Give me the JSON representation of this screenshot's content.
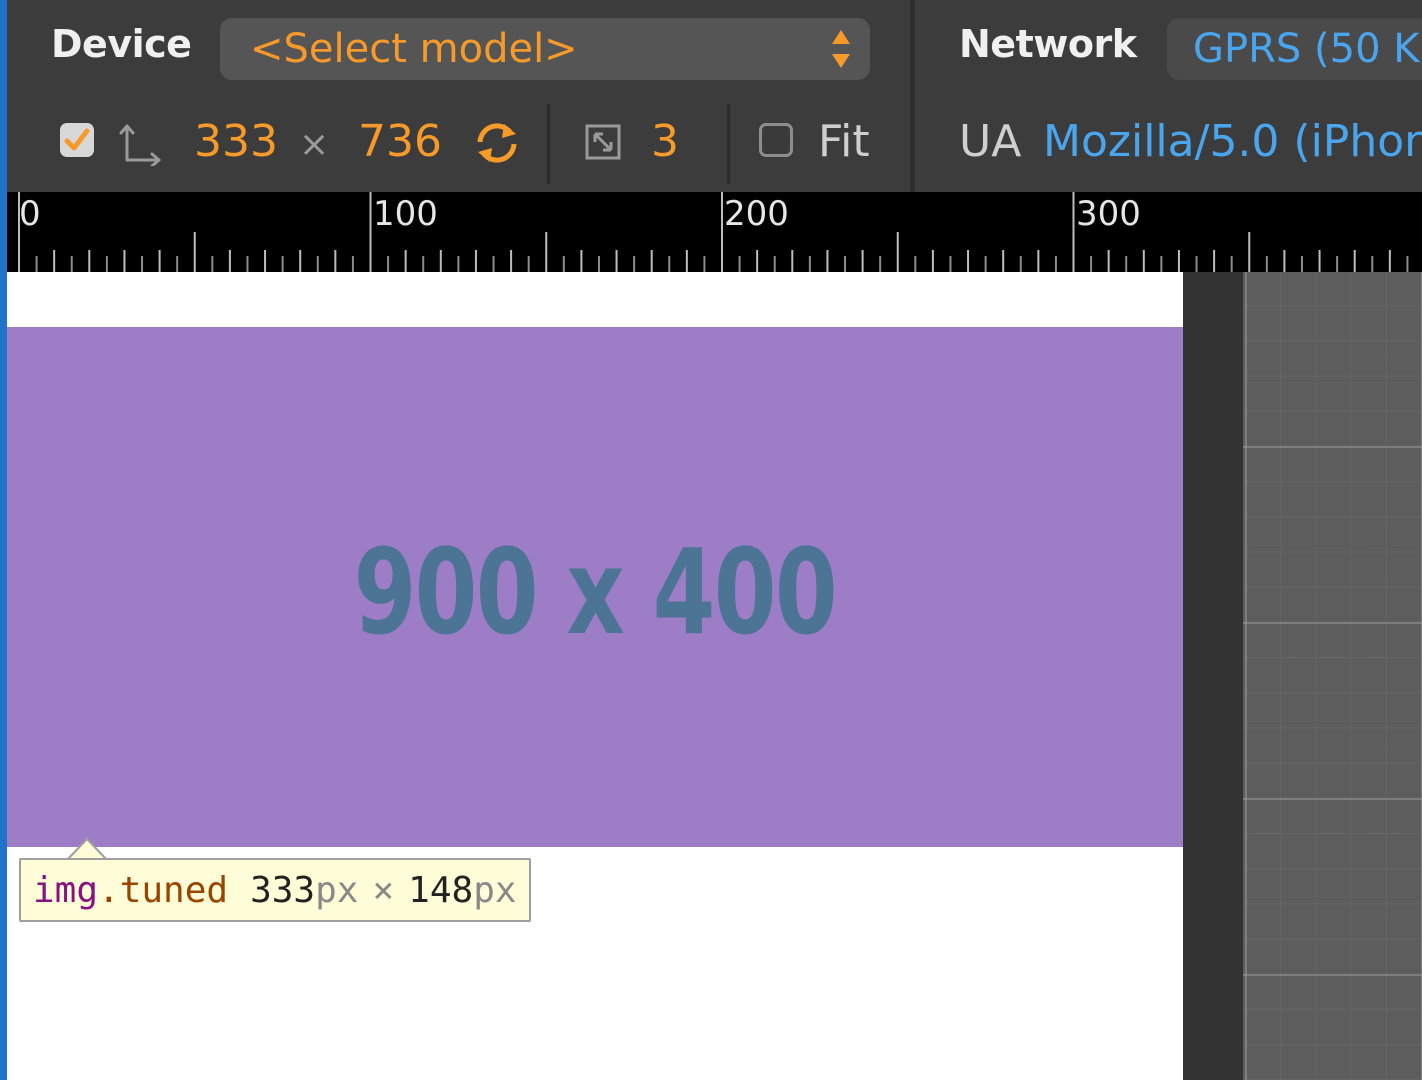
{
  "toolbar": {
    "device_label": "Device",
    "device_select_value": "<Select model>",
    "network_label": "Network",
    "network_value": "GPRS (50 K",
    "width_value": "333",
    "times_symbol": "×",
    "height_value": "736",
    "pixel_ratio": "3",
    "fit_label": "Fit",
    "ua_label": "UA",
    "ua_value": "Mozilla/5.0 (iPhon",
    "dimensions_checkbox_checked": true,
    "fit_checkbox_checked": false
  },
  "ruler": {
    "labels": [
      "0",
      "100",
      "200",
      "300"
    ]
  },
  "viewport": {
    "image_placeholder_text": "900 x 400",
    "image_color": "#9d7dc6"
  },
  "tooltip": {
    "tag": "img",
    "class": ".tuned",
    "width": "333",
    "width_unit": "px",
    "times": "×",
    "height": "148",
    "height_unit": "px"
  },
  "colors": {
    "accent_orange": "#f79a2a",
    "link_blue": "#4aa5ef",
    "toolbar_bg": "#3c3c3c",
    "left_accent": "#1f73c9"
  },
  "icons": {
    "swap_dimensions": "swap-dimensions-icon",
    "rotate": "rotate-icon",
    "zoom": "zoom-icon",
    "select_arrows": "select-arrows-icon",
    "check": "check-icon"
  }
}
